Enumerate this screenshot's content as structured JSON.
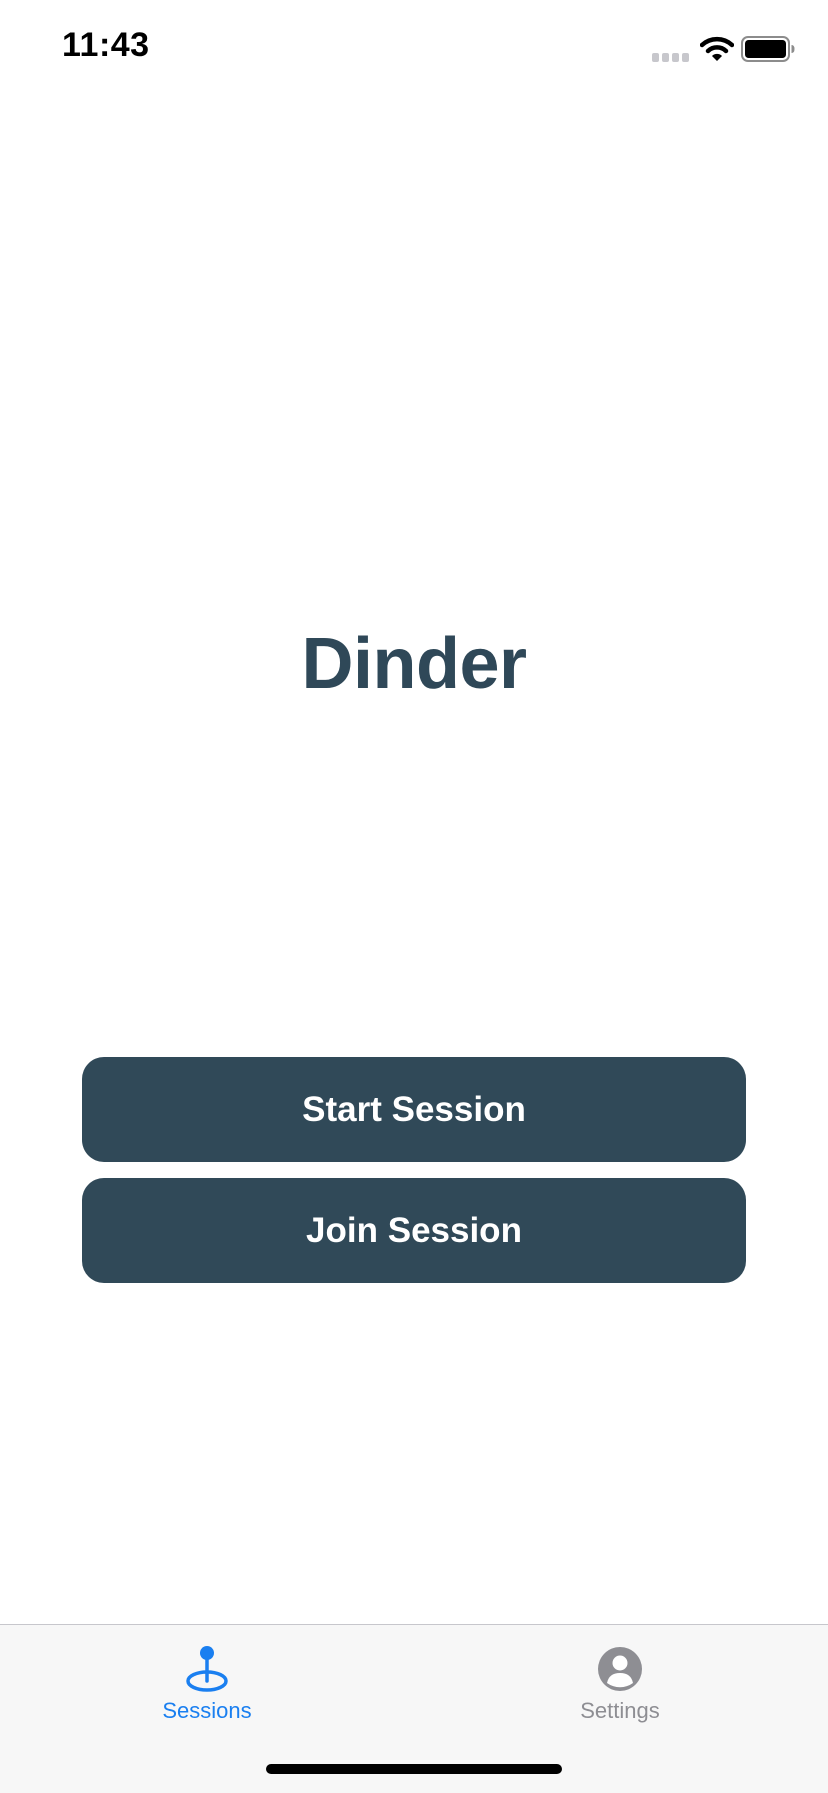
{
  "status_bar": {
    "time": "11:43"
  },
  "app": {
    "title": "Dinder"
  },
  "buttons": {
    "start_label": "Start Session",
    "join_label": "Join Session"
  },
  "tab_bar": {
    "items": [
      {
        "label": "Sessions",
        "icon": "map-pin-icon",
        "active": true
      },
      {
        "label": "Settings",
        "icon": "person-circle-icon",
        "active": false
      }
    ]
  },
  "colors": {
    "primary": "#304958",
    "title": "#2f4858",
    "tab_active": "#1a7ff0",
    "tab_inactive": "#8e8e93",
    "tab_bar_background": "#f7f7f7"
  }
}
